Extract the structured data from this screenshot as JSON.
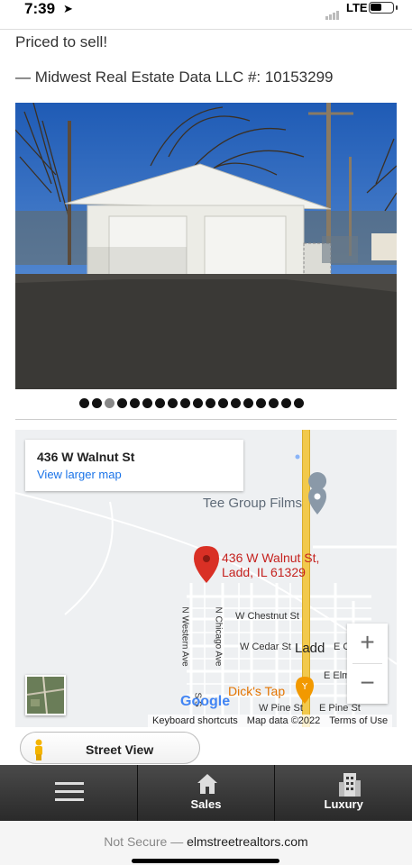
{
  "status_bar": {
    "time": "7:39",
    "network": "LTE"
  },
  "listing": {
    "description_tail": "Priced to sell!",
    "attribution": "— Midwest Real Estate Data LLC #: 10153299"
  },
  "gallery": {
    "total": 18,
    "active_index": 2
  },
  "map": {
    "card_address": "436 W Walnut St",
    "view_larger": "View larger map",
    "poi_tee": "Tee Group Films",
    "pin_line1": "436 W Walnut St,",
    "pin_line2": "Ladd, IL 61329",
    "street_chestnut": "W Chestnut St",
    "street_cedar": "W Cedar St",
    "town": "Ladd",
    "street_ec": "E C",
    "street_eelm": "E Elm",
    "poi_dicks": "Dick's Tap",
    "street_wpine": "W Pine St",
    "street_epine": "E Pine St",
    "street_nwestern": "N Western Ave",
    "street_nchicago": "N Chicago Ave",
    "street_ss": "S S",
    "google_logo": "Google",
    "zoom_in": "+",
    "zoom_out": "−",
    "footer_shortcuts": "Keyboard shortcuts",
    "footer_data": "Map data ©2022",
    "footer_terms": "Terms of Use"
  },
  "street_view": {
    "label": "Street View"
  },
  "nav": {
    "sales": "Sales",
    "luxury": "Luxury"
  },
  "url_bar": {
    "security": "Not Secure —",
    "domain": "elmstreetrealtors.com"
  },
  "colors": {
    "pin": "#d93025",
    "highway": "#f2c94c",
    "link": "#1a73e8",
    "nav_bg": "#3a3a3a"
  }
}
